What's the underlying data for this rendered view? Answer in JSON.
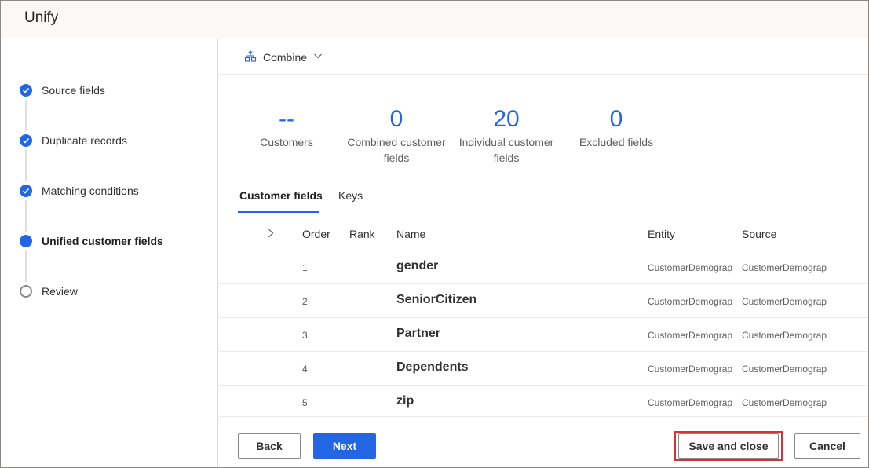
{
  "app": {
    "title": "Unify"
  },
  "steps": [
    {
      "label": "Source fields",
      "state": "done"
    },
    {
      "label": "Duplicate records",
      "state": "done"
    },
    {
      "label": "Matching conditions",
      "state": "done"
    },
    {
      "label": "Unified customer fields",
      "state": "current"
    },
    {
      "label": "Review",
      "state": "pending"
    }
  ],
  "command_bar": {
    "combine_label": "Combine",
    "combine_icon": "combine-icon",
    "dropdown_icon": "chevron-down-icon"
  },
  "stats": [
    {
      "value": "--",
      "label": "Customers"
    },
    {
      "value": "0",
      "label": "Combined customer fields"
    },
    {
      "value": "20",
      "label": "Individual customer fields"
    },
    {
      "value": "0",
      "label": "Excluded fields"
    }
  ],
  "tabs": [
    {
      "label": "Customer fields",
      "active": true
    },
    {
      "label": "Keys",
      "active": false
    }
  ],
  "table": {
    "columns": {
      "order": "Order",
      "rank": "Rank",
      "name": "Name",
      "entity": "Entity",
      "source": "Source"
    },
    "rows": [
      {
        "order": "1",
        "name": "gender",
        "entity": "CustomerDemograp",
        "source": "CustomerDemograp"
      },
      {
        "order": "2",
        "name": "SeniorCitizen",
        "entity": "CustomerDemograp",
        "source": "CustomerDemograp"
      },
      {
        "order": "3",
        "name": "Partner",
        "entity": "CustomerDemograp",
        "source": "CustomerDemograp"
      },
      {
        "order": "4",
        "name": "Dependents",
        "entity": "CustomerDemograp",
        "source": "CustomerDemograp"
      },
      {
        "order": "5",
        "name": "zip",
        "entity": "CustomerDemograp",
        "source": "CustomerDemograp"
      }
    ]
  },
  "footer": {
    "back_label": "Back",
    "next_label": "Next",
    "save_close_label": "Save and close",
    "cancel_label": "Cancel"
  },
  "colors": {
    "accent": "#2266e3",
    "highlight": "#d13438"
  }
}
